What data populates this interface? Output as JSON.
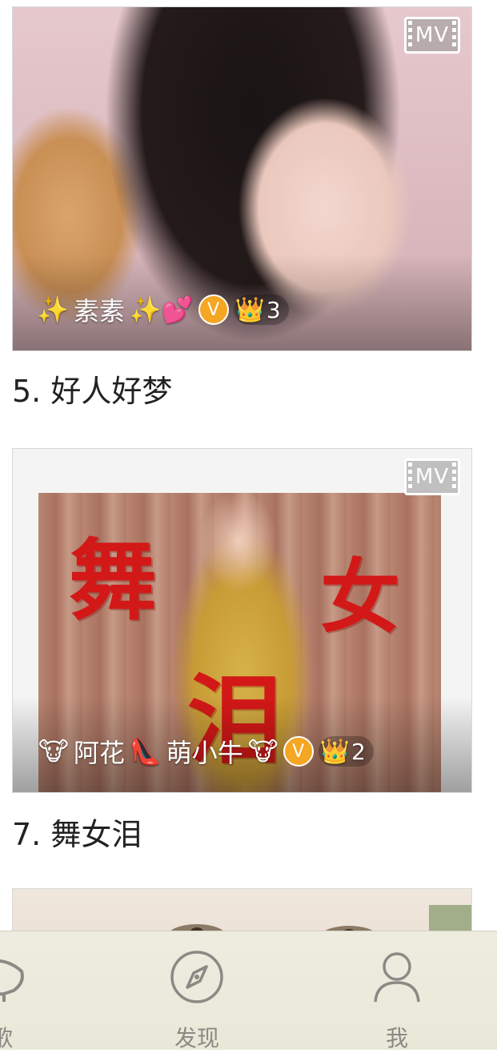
{
  "feed": {
    "items": [
      {
        "mv_label": "MV",
        "author": {
          "prefix_emoji": "✨",
          "name": "素素",
          "suffix_emoji": "✨💕",
          "vip_label": "V",
          "crown_emoji": "👑",
          "crown_count": "3"
        },
        "title": "5. 好人好梦"
      },
      {
        "mv_label": "MV",
        "cover_text": [
          "舞",
          "女",
          "泪"
        ],
        "author": {
          "prefix_emoji": "🐮",
          "name": "阿花",
          "middle_emoji": "👠",
          "name2": "萌小牛",
          "suffix_emoji": "🐮",
          "vip_label": "V",
          "crown_emoji": "👑",
          "crown_count": "2"
        },
        "title": "7. 舞女泪"
      }
    ]
  },
  "tab_bar": {
    "items": [
      {
        "label": "歌",
        "icon": "song-icon"
      },
      {
        "label": "发现",
        "icon": "compass-icon"
      },
      {
        "label": "我",
        "icon": "person-icon"
      }
    ],
    "color": "#8a8a85"
  },
  "colors": {
    "vip_badge": "#f5a623",
    "cover_text": "#d31818"
  }
}
